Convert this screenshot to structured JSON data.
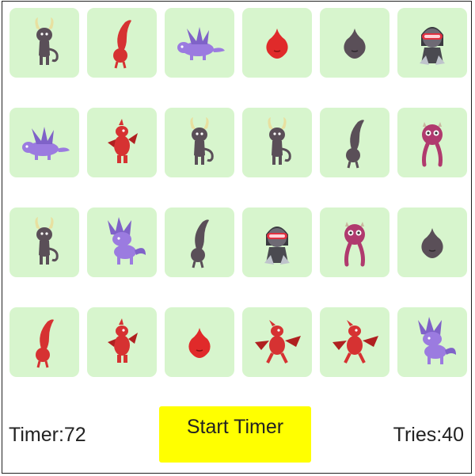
{
  "board": {
    "cards": [
      {
        "creature": "horned-imp-icon",
        "color": "#5a4f58"
      },
      {
        "creature": "red-leaf-sprite-icon",
        "color": "#d63232"
      },
      {
        "creature": "purple-dragon-icon",
        "color": "#9b7be0"
      },
      {
        "creature": "red-blob-icon",
        "color": "#e02a2a"
      },
      {
        "creature": "gray-blob-icon",
        "color": "#5a4f58"
      },
      {
        "creature": "goggle-ninja-icon",
        "color": "#6e6a74"
      },
      {
        "creature": "purple-dragon-icon",
        "color": "#9b7be0"
      },
      {
        "creature": "red-dragon-icon",
        "color": "#d63232"
      },
      {
        "creature": "horned-imp-icon",
        "color": "#5a4f58"
      },
      {
        "creature": "horned-imp-icon",
        "color": "#5a4f58"
      },
      {
        "creature": "gray-leaf-sprite-icon",
        "color": "#5a4f58"
      },
      {
        "creature": "magenta-tentacle-icon",
        "color": "#b03a6e"
      },
      {
        "creature": "horned-imp-icon",
        "color": "#5a4f58"
      },
      {
        "creature": "purple-wolf-icon",
        "color": "#9b7be0"
      },
      {
        "creature": "gray-leaf-sprite-icon",
        "color": "#5a4f58"
      },
      {
        "creature": "goggle-ninja-icon",
        "color": "#6e6a74"
      },
      {
        "creature": "magenta-tentacle-icon",
        "color": "#b03a6e"
      },
      {
        "creature": "gray-blob-icon",
        "color": "#5a4f58"
      },
      {
        "creature": "red-leaf-sprite-icon",
        "color": "#d63232"
      },
      {
        "creature": "red-dragon-icon",
        "color": "#d63232"
      },
      {
        "creature": "red-blob-icon",
        "color": "#e02a2a"
      },
      {
        "creature": "red-winged-dragon-icon",
        "color": "#d63232"
      },
      {
        "creature": "red-winged-dragon-icon",
        "color": "#d63232"
      },
      {
        "creature": "purple-wolf-icon",
        "color": "#9b7be0"
      }
    ],
    "card_background": "#d7f5cd"
  },
  "status": {
    "timer_text": "Timer:72",
    "tries_text": "Tries:40"
  },
  "controls": {
    "start_label": "Start Timer",
    "start_color": "#ffff00"
  }
}
